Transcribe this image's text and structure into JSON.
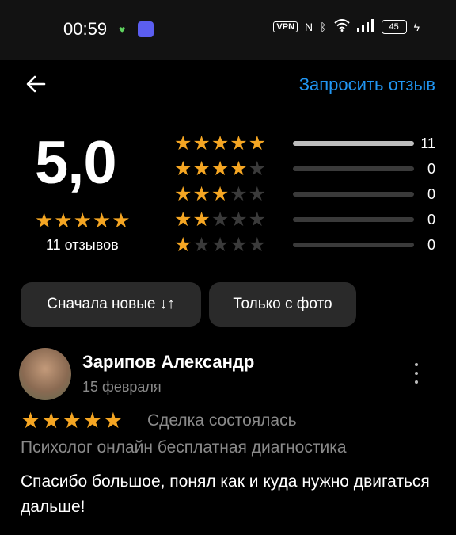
{
  "status_bar": {
    "time": "00:59",
    "vpn_label": "VPN",
    "battery_level": "45"
  },
  "header": {
    "request_review_label": "Запросить отзыв"
  },
  "rating": {
    "score": "5,0",
    "score_stars": "★★★★★",
    "reviews_count_label": "11 отзывов",
    "distribution": [
      {
        "stars": 5,
        "count": "11",
        "fraction": 1.0
      },
      {
        "stars": 4,
        "count": "0",
        "fraction": 0
      },
      {
        "stars": 3,
        "count": "0",
        "fraction": 0
      },
      {
        "stars": 2,
        "count": "0",
        "fraction": 0
      },
      {
        "stars": 1,
        "count": "0",
        "fraction": 0
      }
    ]
  },
  "filters": {
    "sort_label": "Сначала новые ↓↑",
    "photo_only_label": "Только с фото"
  },
  "review": {
    "author": "Зарипов Александр",
    "date": "15 февраля",
    "stars": "★★★★★",
    "deal_status": "Сделка состоялась",
    "service": "Психолог онлайн бесплатная диагностика",
    "text": "Спасибо большое, понял как и куда нужно двигаться дальше!"
  },
  "colors": {
    "accent": "#2196f3",
    "star": "#f5a623",
    "background": "#000000"
  }
}
